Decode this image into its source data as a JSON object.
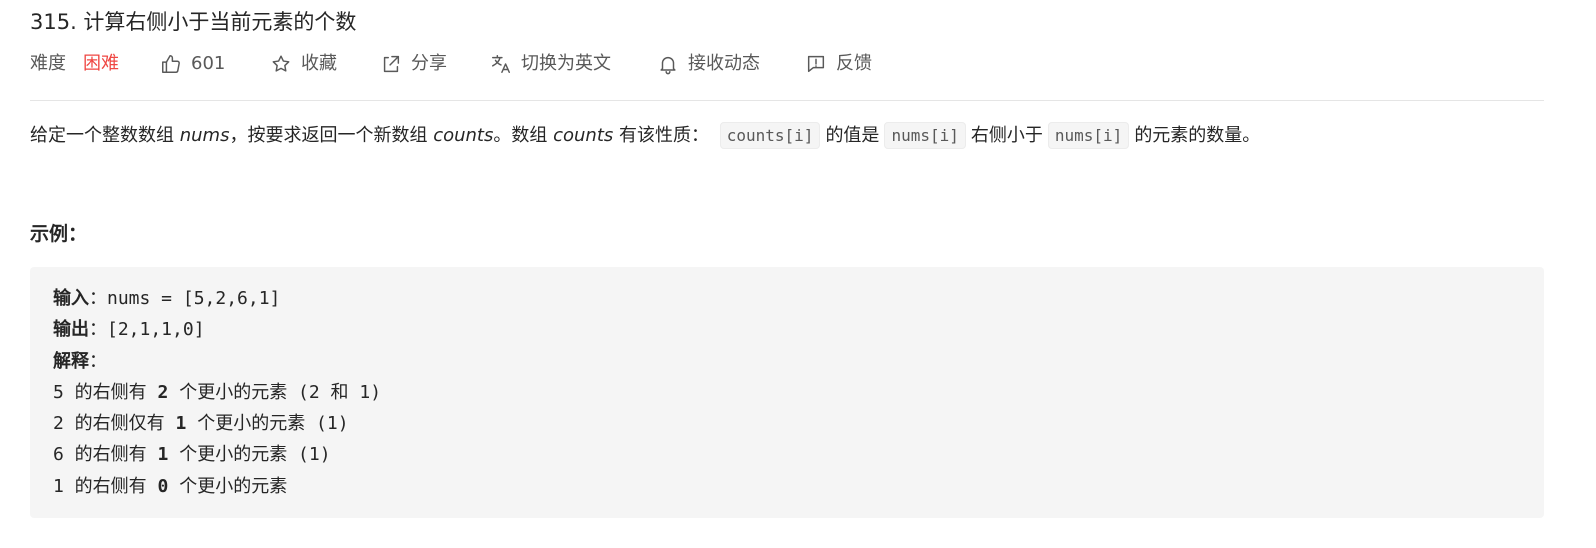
{
  "problem": {
    "title": "315. 计算右侧小于当前元素的个数"
  },
  "meta": {
    "difficulty_label": "难度",
    "difficulty_value": "困难",
    "likes": "601",
    "favorite_label": "收藏",
    "share_label": "分享",
    "switch_lang_label": "切换为英文",
    "notify_label": "接收动态",
    "feedback_label": "反馈",
    "difficulty_color": "#ef4743"
  },
  "description": {
    "part1": "给定一个整数数组 ",
    "var_nums": "nums",
    "part2": "，按要求返回一个新数组 ",
    "var_counts": "counts",
    "part3": "。数组 ",
    "var_counts2": "counts",
    "part4": " 有该性质： ",
    "code1": "counts[i]",
    "part5": "的值是",
    "code2": "nums[i]",
    "part6": "右侧小于",
    "code3": "nums[i]",
    "part7": "的元素的数量。"
  },
  "example": {
    "heading": "示例：",
    "input_label": "输入",
    "input_value": "：nums = [5,2,6,1]",
    "output_label": "输出",
    "output_value": "：[2,1,1,0]",
    "explain_label": "解释",
    "explain_colon": "：",
    "lines": [
      {
        "pre": "5 的右侧有 ",
        "num": "2",
        "post": " 个更小的元素 (2 和 1)"
      },
      {
        "pre": "2 的右侧仅有 ",
        "num": "1",
        "post": " 个更小的元素 (1)"
      },
      {
        "pre": "6 的右侧有 ",
        "num": "1",
        "post": " 个更小的元素 (1)"
      },
      {
        "pre": "1 的右侧有 ",
        "num": "0",
        "post": " 个更小的元素"
      }
    ]
  },
  "icons": {
    "like": "thumbs-up-icon",
    "favorite": "star-icon",
    "share": "share-icon",
    "translate": "translate-icon",
    "notify": "bell-icon",
    "feedback": "feedback-icon"
  }
}
